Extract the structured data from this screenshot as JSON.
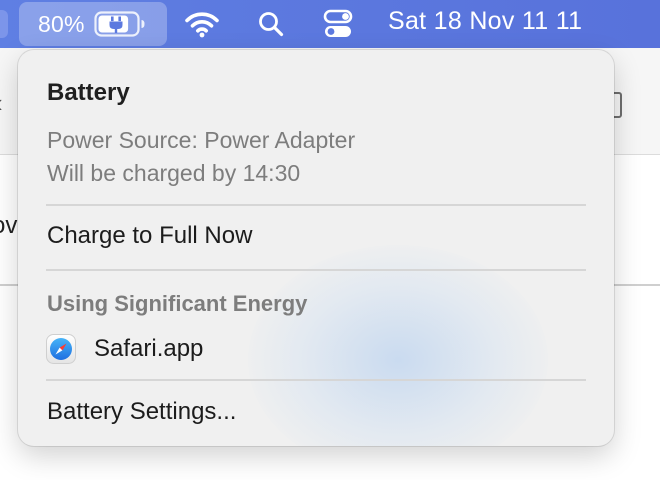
{
  "menubar": {
    "battery_percent": "80%",
    "battery_level": 0.8,
    "clock": "Sat 18 Nov  11 11",
    "icons": [
      "battery-charging-icon",
      "wifi-icon",
      "spotlight-search-icon",
      "control-center-icon"
    ]
  },
  "battery_menu": {
    "title": "Battery",
    "power_source": "Power Source: Power Adapter",
    "charge_status": "Will be charged by 14:30",
    "charge_full_label": "Charge to Full Now",
    "significant_energy_header": "Using Significant Energy",
    "apps": [
      {
        "name": "Safari.app",
        "icon": "safari-icon"
      }
    ],
    "settings_label": "Battery Settings..."
  },
  "background_window": {
    "back_glyph": "‹",
    "partial_text": "ov"
  },
  "colors": {
    "menubar": "#5c79df",
    "panel": "#f0f0f0",
    "secondary_text": "#7d7d7d",
    "safari_blue": "#2f8cf0"
  }
}
